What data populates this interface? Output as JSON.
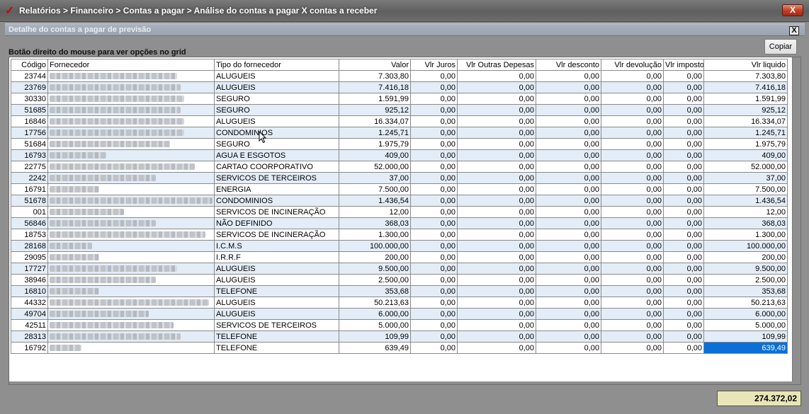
{
  "window": {
    "title": "Relatórios > Financeiro > Contas a pagar > Análise do contas a pagar X contas a receber",
    "close_label": "X"
  },
  "dialog": {
    "title": "Detalhe do contas a pagar de previsão",
    "close_label": "X",
    "hint": "Botão direito do mouse para ver opções no grid",
    "copy_label": "Copiar"
  },
  "grid": {
    "columns": [
      "Código",
      "Fornecedor",
      "Tipo do fornecedor",
      "Valor",
      "Vlr Juros",
      "Vlr Outras Depesas",
      "Vlr desconto",
      "Vlr devolução",
      "Vlr imposto",
      "Vlr liquido"
    ],
    "rows": [
      {
        "codigo": "23744",
        "tipo": "ALUGUEIS",
        "valor": "7.303,80",
        "juros": "0,00",
        "outras": "0,00",
        "desconto": "0,00",
        "devolucao": "0,00",
        "imposto": "0,00",
        "liquido": "7.303,80"
      },
      {
        "codigo": "23769",
        "tipo": "ALUGUEIS",
        "valor": "7.416,18",
        "juros": "0,00",
        "outras": "0,00",
        "desconto": "0,00",
        "devolucao": "0,00",
        "imposto": "0,00",
        "liquido": "7.416,18"
      },
      {
        "codigo": "30330",
        "tipo": "SEGURO",
        "valor": "1.591,99",
        "juros": "0,00",
        "outras": "0,00",
        "desconto": "0,00",
        "devolucao": "0,00",
        "imposto": "0,00",
        "liquido": "1.591,99"
      },
      {
        "codigo": "51685",
        "tipo": "SEGURO",
        "valor": "925,12",
        "juros": "0,00",
        "outras": "0,00",
        "desconto": "0,00",
        "devolucao": "0,00",
        "imposto": "0,00",
        "liquido": "925,12"
      },
      {
        "codigo": "16846",
        "tipo": "ALUGUEIS",
        "valor": "16.334,07",
        "juros": "0,00",
        "outras": "0,00",
        "desconto": "0,00",
        "devolucao": "0,00",
        "imposto": "0,00",
        "liquido": "16.334,07"
      },
      {
        "codigo": "17756",
        "tipo": "CONDOMINIOS",
        "valor": "1.245,71",
        "juros": "0,00",
        "outras": "0,00",
        "desconto": "0,00",
        "devolucao": "0,00",
        "imposto": "0,00",
        "liquido": "1.245,71"
      },
      {
        "codigo": "51684",
        "tipo": "SEGURO",
        "valor": "1.975,79",
        "juros": "0,00",
        "outras": "0,00",
        "desconto": "0,00",
        "devolucao": "0,00",
        "imposto": "0,00",
        "liquido": "1.975,79"
      },
      {
        "codigo": "16793",
        "tipo": "AGUA E ESGOTOS",
        "valor": "409,00",
        "juros": "0,00",
        "outras": "0,00",
        "desconto": "0,00",
        "devolucao": "0,00",
        "imposto": "0,00",
        "liquido": "409,00"
      },
      {
        "codigo": "22775",
        "tipo": "CARTAO COORPORATIVO",
        "valor": "52.000,00",
        "juros": "0,00",
        "outras": "0,00",
        "desconto": "0,00",
        "devolucao": "0,00",
        "imposto": "0,00",
        "liquido": "52.000,00"
      },
      {
        "codigo": "2242",
        "tipo": "SERVICOS DE TERCEIROS",
        "valor": "37,00",
        "juros": "0,00",
        "outras": "0,00",
        "desconto": "0,00",
        "devolucao": "0,00",
        "imposto": "0,00",
        "liquido": "37,00"
      },
      {
        "codigo": "16791",
        "tipo": "ENERGIA",
        "valor": "7.500,00",
        "juros": "0,00",
        "outras": "0,00",
        "desconto": "0,00",
        "devolucao": "0,00",
        "imposto": "0,00",
        "liquido": "7.500,00"
      },
      {
        "codigo": "51678",
        "tipo": "CONDOMINIOS",
        "valor": "1.436,54",
        "juros": "0,00",
        "outras": "0,00",
        "desconto": "0,00",
        "devolucao": "0,00",
        "imposto": "0,00",
        "liquido": "1.436,54"
      },
      {
        "codigo": "001",
        "tipo": "SERVICOS DE INCINERAÇÃO",
        "valor": "12,00",
        "juros": "0,00",
        "outras": "0,00",
        "desconto": "0,00",
        "devolucao": "0,00",
        "imposto": "0,00",
        "liquido": "12,00"
      },
      {
        "codigo": "56846",
        "tipo": "NÃO DEFINIDO",
        "valor": "368,03",
        "juros": "0,00",
        "outras": "0,00",
        "desconto": "0,00",
        "devolucao": "0,00",
        "imposto": "0,00",
        "liquido": "368,03"
      },
      {
        "codigo": "18753",
        "tipo": "SERVICOS DE INCINERAÇÃO",
        "valor": "1.300,00",
        "juros": "0,00",
        "outras": "0,00",
        "desconto": "0,00",
        "devolucao": "0,00",
        "imposto": "0,00",
        "liquido": "1.300,00"
      },
      {
        "codigo": "28168",
        "tipo": "I.C.M.S",
        "valor": "100.000,00",
        "juros": "0,00",
        "outras": "0,00",
        "desconto": "0,00",
        "devolucao": "0,00",
        "imposto": "0,00",
        "liquido": "100.000,00"
      },
      {
        "codigo": "29095",
        "tipo": "I.R.R.F",
        "valor": "200,00",
        "juros": "0,00",
        "outras": "0,00",
        "desconto": "0,00",
        "devolucao": "0,00",
        "imposto": "0,00",
        "liquido": "200,00"
      },
      {
        "codigo": "17727",
        "tipo": "ALUGUEIS",
        "valor": "9.500,00",
        "juros": "0,00",
        "outras": "0,00",
        "desconto": "0,00",
        "devolucao": "0,00",
        "imposto": "0,00",
        "liquido": "9.500,00"
      },
      {
        "codigo": "38946",
        "tipo": "ALUGUEIS",
        "valor": "2.500,00",
        "juros": "0,00",
        "outras": "0,00",
        "desconto": "0,00",
        "devolucao": "0,00",
        "imposto": "0,00",
        "liquido": "2.500,00"
      },
      {
        "codigo": "16810",
        "tipo": "TELEFONE",
        "valor": "353,68",
        "juros": "0,00",
        "outras": "0,00",
        "desconto": "0,00",
        "devolucao": "0,00",
        "imposto": "0,00",
        "liquido": "353,68"
      },
      {
        "codigo": "44332",
        "tipo": "ALUGUEIS",
        "valor": "50.213,63",
        "juros": "0,00",
        "outras": "0,00",
        "desconto": "0,00",
        "devolucao": "0,00",
        "imposto": "0,00",
        "liquido": "50.213,63"
      },
      {
        "codigo": "49704",
        "tipo": "ALUGUEIS",
        "valor": "6.000,00",
        "juros": "0,00",
        "outras": "0,00",
        "desconto": "0,00",
        "devolucao": "0,00",
        "imposto": "0,00",
        "liquido": "6.000,00"
      },
      {
        "codigo": "42511",
        "tipo": "SERVICOS DE TERCEIROS",
        "valor": "5.000,00",
        "juros": "0,00",
        "outras": "0,00",
        "desconto": "0,00",
        "devolucao": "0,00",
        "imposto": "0,00",
        "liquido": "5.000,00"
      },
      {
        "codigo": "28313",
        "tipo": "TELEFONE",
        "valor": "109,99",
        "juros": "0,00",
        "outras": "0,00",
        "desconto": "0,00",
        "devolucao": "0,00",
        "imposto": "0,00",
        "liquido": "109,99"
      },
      {
        "codigo": "16792",
        "tipo": "TELEFONE",
        "valor": "639,49",
        "juros": "0,00",
        "outras": "0,00",
        "desconto": "0,00",
        "devolucao": "0,00",
        "imposto": "0,00",
        "liquido": "639,49",
        "selected_cell": "liquido"
      }
    ]
  },
  "total": "274.372,02",
  "colors": {
    "selection": "#0a6fd9",
    "alt_row": "#e3edf7",
    "total_bg": "#e8e6b8",
    "close_red": "#c0422a"
  },
  "icons": [
    "app-check-icon",
    "window-close-icon",
    "dialog-close-icon",
    "mouse-pointer-icon"
  ]
}
